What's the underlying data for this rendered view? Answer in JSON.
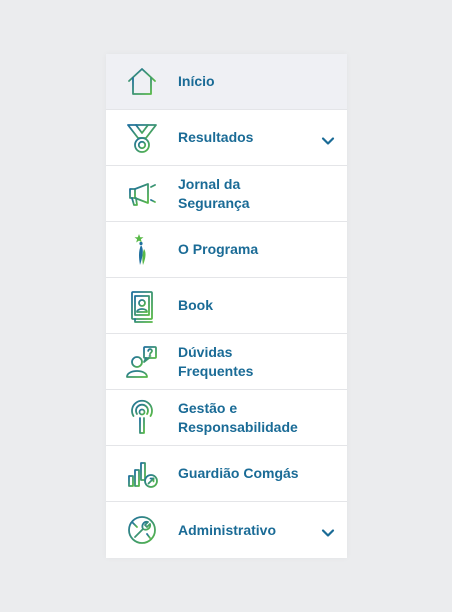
{
  "menu": {
    "items": [
      {
        "label": "Início",
        "icon": "home-icon",
        "active": true
      },
      {
        "label": "Resultados",
        "icon": "medal-icon",
        "expandable": true
      },
      {
        "label": "Jornal da\nSegurança",
        "icon": "megaphone-icon"
      },
      {
        "label": "O Programa",
        "icon": "figure-star-icon"
      },
      {
        "label": "Book",
        "icon": "book-profile-icon"
      },
      {
        "label": "Dúvidas Frequentes",
        "icon": "person-question-icon"
      },
      {
        "label": "Gestão e\nResponsabilidade",
        "icon": "antenna-icon"
      },
      {
        "label": "Guardião Comgás",
        "icon": "bar-chart-shield-icon"
      },
      {
        "label": "Administrativo",
        "icon": "wrench-circle-icon",
        "expandable": true
      }
    ]
  },
  "colors": {
    "label": "#1a6b96",
    "icon_blue": "#1f6f9e",
    "icon_green": "#58b947",
    "active_bg": "#eff0f4",
    "page_bg": "#ebecee"
  }
}
